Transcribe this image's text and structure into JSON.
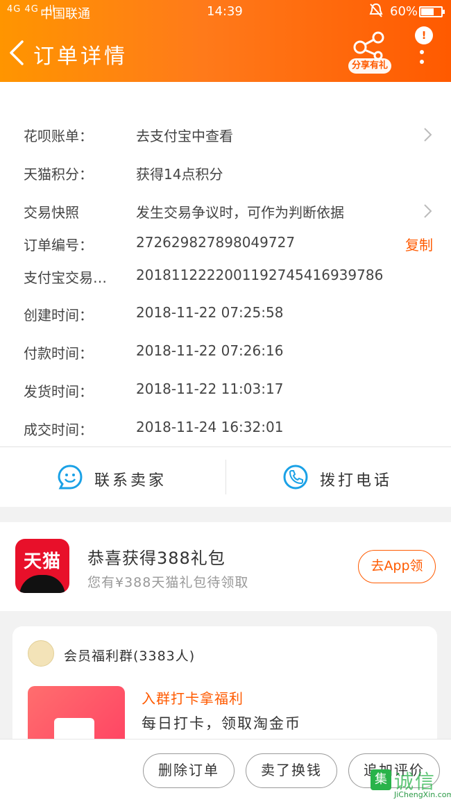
{
  "status_bar": {
    "signal": "4G 4G .ıll",
    "carrier": "中国联通",
    "time": "14:39",
    "battery_pct": "60%",
    "battery_level": 0.6
  },
  "header": {
    "title": "订单详情",
    "share_label": "分享有礼",
    "notice_badge": "!"
  },
  "order_info": [
    {
      "key": "花呗账单：",
      "value": "去支付宝中查看",
      "chevron": true
    },
    {
      "key": "天猫积分：",
      "value": "获得14点积分"
    },
    {
      "key": "交易快照",
      "value": "发生交易争议时，可作为判断依据",
      "chevron": true
    },
    {
      "key": "订单编号：",
      "value": "272629827898049727",
      "action": "复制"
    },
    {
      "key": "支付宝交易…",
      "value": "2018112222001192745416939786"
    },
    {
      "key": "创建时间：",
      "value": "2018-11-22 07:25:58"
    },
    {
      "key": "付款时间：",
      "value": "2018-11-22 07:26:16"
    },
    {
      "key": "发货时间：",
      "value": "2018-11-22 11:03:17"
    },
    {
      "key": "成交时间：",
      "value": "2018-11-24 16:32:01"
    }
  ],
  "contact": {
    "seller": "联系卖家",
    "phone": "拨打电话"
  },
  "promo": {
    "logo_text": "天猫",
    "title": "恭喜获得388礼包",
    "subtitle": "您有¥388天猫礼包待领取",
    "button": "去App领"
  },
  "group": {
    "name": "会员福利群(3383人)",
    "post_title": "入群打卡拿福利",
    "post_desc": "每日打卡，领取淘金币"
  },
  "bottom_actions": [
    "删除订单",
    "卖了换钱",
    "追加评价"
  ],
  "watermark": {
    "text": "诚信",
    "box": "集",
    "url": "JiChengXin.com"
  },
  "colors": {
    "accent": "#ff5a00",
    "header_start": "#ff9500",
    "tmall_red": "#e8102a"
  }
}
